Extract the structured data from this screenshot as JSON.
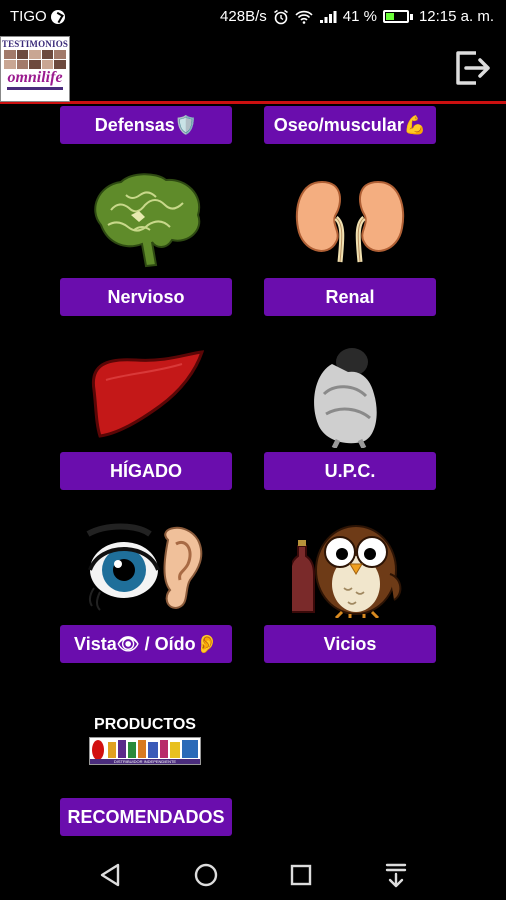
{
  "status_bar": {
    "carrier": "TIGO",
    "net_speed": "428B/s",
    "battery": "41 %",
    "battery_level": 0.41,
    "time": "12:15 a. m."
  },
  "app_bar": {
    "logo_title": "TESTIMONIOS",
    "logo_brand": "omnilife",
    "exit_icon": "exit-icon"
  },
  "categories": [
    {
      "label": "Defensas🛡️",
      "icon": "shield-icon"
    },
    {
      "label": "Oseo/muscular💪",
      "icon": "muscle-icon"
    },
    {
      "label": "Nervioso",
      "icon": "brain-icon"
    },
    {
      "label": "Renal",
      "icon": "kidneys-icon"
    },
    {
      "label": "HÍGADO",
      "icon": "liver-icon"
    },
    {
      "label": "U.P.C.",
      "icon": "person-crouching-icon"
    },
    {
      "label": "Vista👁 / Oído👂",
      "icon": "eye-ear-icon"
    },
    {
      "label": "Vicios",
      "icon": "owl-bottle-icon"
    },
    {
      "label": "RECOMENDADOS",
      "icon": "productos-logo"
    }
  ],
  "productos_logo": {
    "title": "PRODUCTOS",
    "subtitle": "DISTRIBUIDOR INDEPENDIENTE"
  },
  "nav_bar": {
    "back": "back-icon",
    "home": "home-icon",
    "recents": "recents-icon",
    "notifications": "notification-down-icon"
  },
  "colors": {
    "button": "#6a0dad",
    "divider": "#cc1010",
    "background": "#000000"
  }
}
